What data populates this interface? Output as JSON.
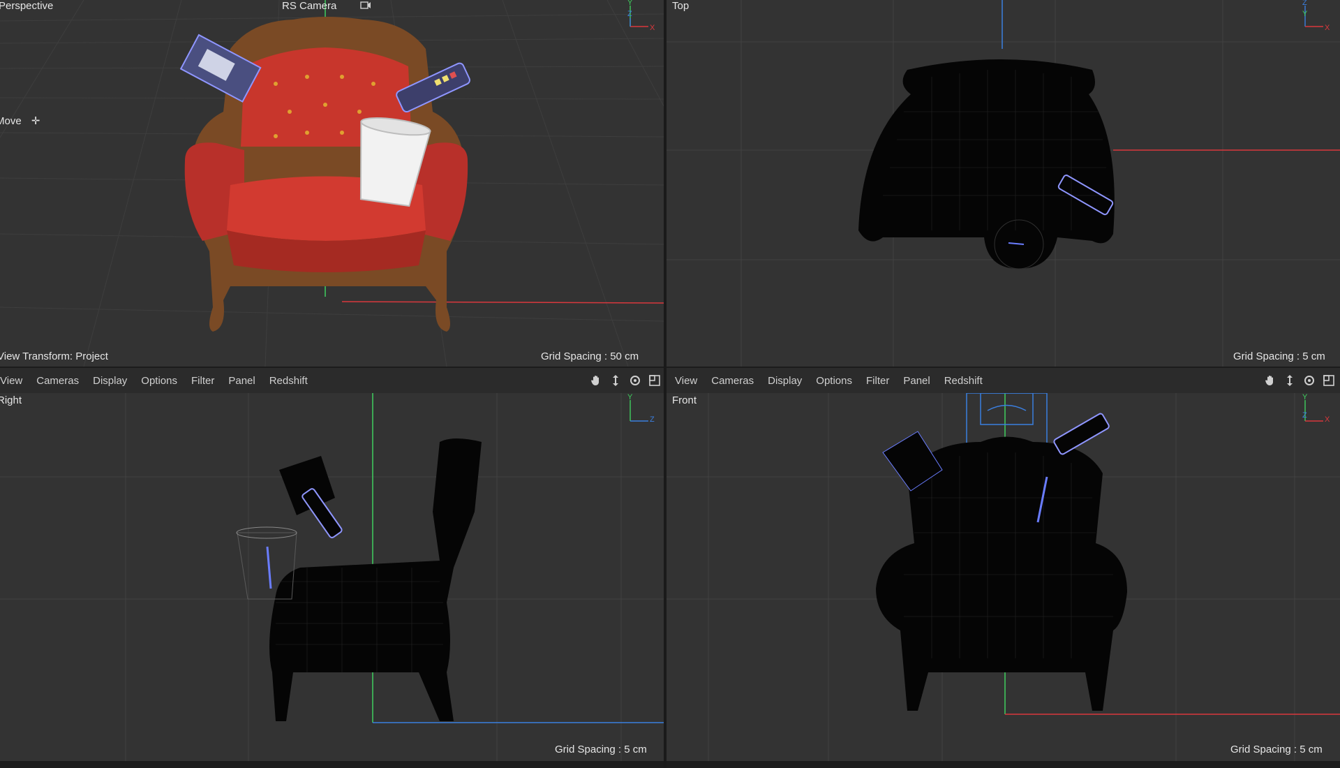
{
  "viewports": {
    "perspective": {
      "name": "Perspective",
      "camera": "RS Camera",
      "tool": "Move",
      "view_transform": "View Transform: Project",
      "grid_spacing": "Grid Spacing : 50 cm"
    },
    "top": {
      "name": "Top",
      "grid_spacing": "Grid Spacing : 5 cm"
    },
    "right": {
      "name": "Right",
      "grid_spacing": "Grid Spacing : 5 cm"
    },
    "front": {
      "name": "Front",
      "grid_spacing": "Grid Spacing : 5 cm"
    }
  },
  "menubar_left": [
    "View",
    "Cameras",
    "Display",
    "Options",
    "Filter",
    "Panel",
    "Redshift"
  ],
  "menubar_right": [
    "View",
    "Cameras",
    "Display",
    "Options",
    "Filter",
    "Panel",
    "Redshift"
  ],
  "menubar_icons": [
    "hand-pan-icon",
    "move-view-icon",
    "rotate-view-icon",
    "maximize-view-icon"
  ],
  "axis_labels": {
    "x": "X",
    "y": "Y",
    "z": "Z"
  },
  "colors": {
    "viewport_bg": "#333333",
    "grid": "#424242",
    "axis_x": "#d9383d",
    "axis_y": "#3fcf5f",
    "axis_z": "#3b7fe0",
    "chair_red": "#c8362c",
    "chair_wood": "#7a4a25",
    "wire_blue": "#6a7dff"
  }
}
